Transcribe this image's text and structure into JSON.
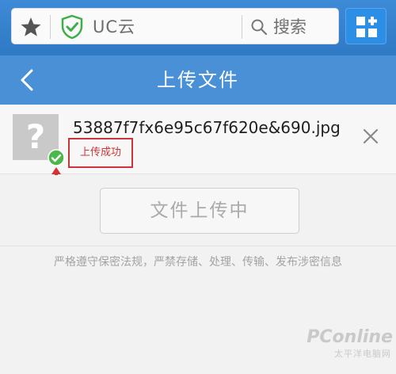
{
  "browser": {
    "site_label": "UC云",
    "search_label": "搜索",
    "icons": {
      "bookmark": "star-icon",
      "security": "shield-check-icon",
      "search": "search-icon",
      "apps": "apps-grid-icon"
    },
    "accent_color": "#2f79c4"
  },
  "header": {
    "title": "上传文件",
    "back_icon": "chevron-left-icon"
  },
  "file": {
    "name": "53887f7fx6e95c67f620e&690.jpg",
    "status": "上传成功",
    "thumbnail_glyph": "?",
    "status_color": "#d23434"
  },
  "upload": {
    "button_label": "文件上传中"
  },
  "notice": "严格遵守保密法规，严禁存储、处理、传输、发布涉密信息",
  "watermark": {
    "main": "PConline",
    "sub": "太平洋电脑网"
  }
}
